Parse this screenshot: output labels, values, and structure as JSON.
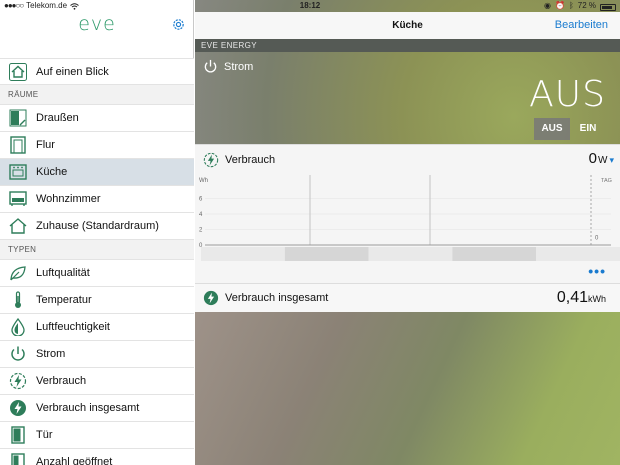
{
  "status_bar": {
    "carrier": "Telekom.de",
    "time": "18:12",
    "battery": "72 %"
  },
  "sidebar": {
    "logo": "eve",
    "overview": "Auf einen Blick",
    "rooms_heading": "RÄUME",
    "rooms": [
      {
        "label": "Draußen",
        "icon": "outdoor-icon",
        "active": false
      },
      {
        "label": "Flur",
        "icon": "door-frame-icon",
        "active": false
      },
      {
        "label": "Küche",
        "icon": "oven-icon",
        "active": true
      },
      {
        "label": "Wohnzimmer",
        "icon": "sofa-icon",
        "active": false
      },
      {
        "label": "Zuhause (Standardraum)",
        "icon": "house-icon",
        "active": false
      }
    ],
    "types_heading": "TYPEN",
    "types": [
      {
        "label": "Luftqualität",
        "icon": "leaf-icon"
      },
      {
        "label": "Temperatur",
        "icon": "thermometer-icon"
      },
      {
        "label": "Luftfeuchtigkeit",
        "icon": "droplet-icon"
      },
      {
        "label": "Strom",
        "icon": "power-icon"
      },
      {
        "label": "Verbrauch",
        "icon": "bolt-outline-icon"
      },
      {
        "label": "Verbrauch insgesamt",
        "icon": "bolt-filled-icon"
      },
      {
        "label": "Tür",
        "icon": "door-icon"
      },
      {
        "label": "Anzahl geöffnet",
        "icon": "door-count-icon"
      }
    ]
  },
  "header": {
    "title": "Küche",
    "edit": "Bearbeiten"
  },
  "device": {
    "name": "EVE ENERGY",
    "power_label": "Strom",
    "power_state": "AUS",
    "toggle_off": "AUS",
    "toggle_on": "EIN"
  },
  "consumption": {
    "label": "Verbrauch",
    "value": "0",
    "unit": "W",
    "chart_data": {
      "type": "line",
      "ylabel": "Wh",
      "y_ticks": [
        "6",
        "4",
        "2",
        "0"
      ],
      "ylim": [
        0,
        8
      ],
      "period_label": "TAG",
      "current_value_label": "0",
      "values": [
        0,
        0,
        0,
        0,
        0,
        0,
        0,
        0,
        0,
        0
      ]
    }
  },
  "total": {
    "label": "Verbrauch insgesamt",
    "value": "0,41",
    "unit": "kWh"
  },
  "colors": {
    "accent": "#1a7bcf",
    "brand_green": "#2e9a6a",
    "active_row": "#d7dfe6"
  }
}
